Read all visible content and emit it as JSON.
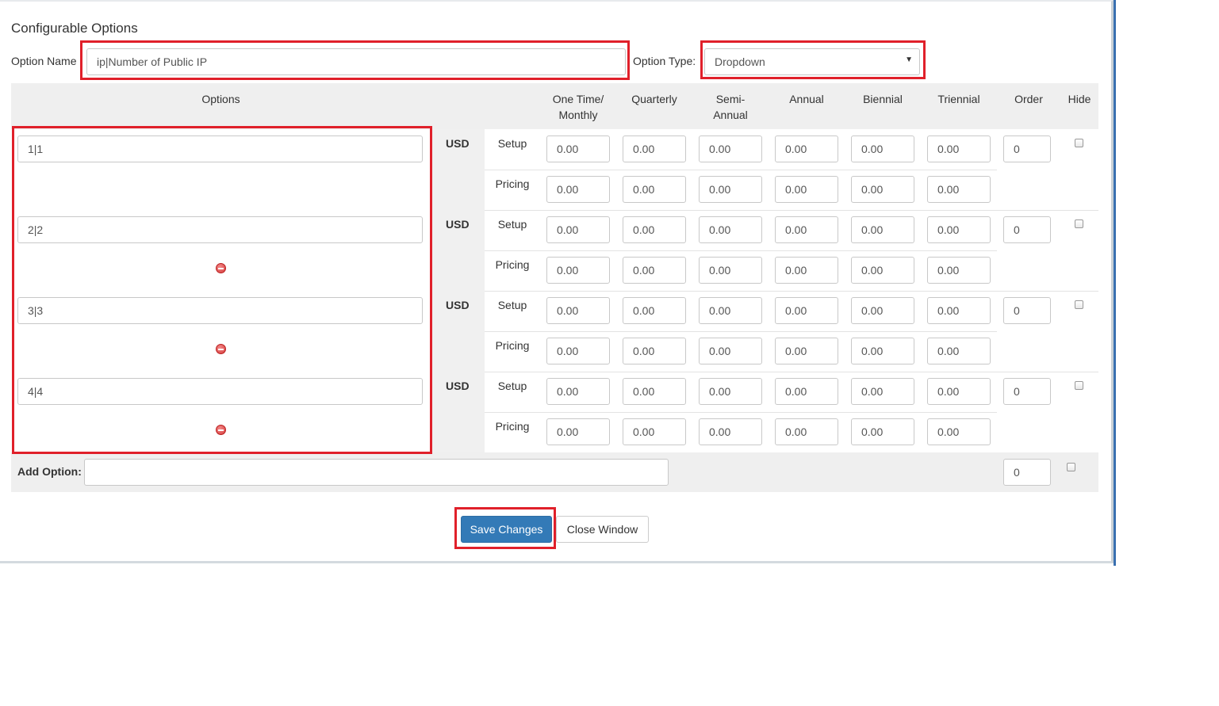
{
  "title": "Configurable Options",
  "option_name": {
    "label": "Option Name",
    "value": "ip|Number of Public IP"
  },
  "option_type": {
    "label": "Option Type:",
    "value": "Dropdown"
  },
  "columns": {
    "options": "Options",
    "one_time_a": "One Time/",
    "one_time_b": "Monthly",
    "quarterly": "Quarterly",
    "semi_a": "Semi-",
    "semi_b": "Annual",
    "annual": "Annual",
    "biennial": "Biennial",
    "triennial": "Triennial",
    "order": "Order",
    "hide": "Hide"
  },
  "currency": "USD",
  "setup_label": "Setup",
  "pricing_label": "Pricing",
  "rows": [
    {
      "name": "1|1",
      "setup": [
        "0.00",
        "0.00",
        "0.00",
        "0.00",
        "0.00",
        "0.00"
      ],
      "pricing": [
        "0.00",
        "0.00",
        "0.00",
        "0.00",
        "0.00",
        "0.00"
      ],
      "order": "0"
    },
    {
      "name": "2|2",
      "setup": [
        "0.00",
        "0.00",
        "0.00",
        "0.00",
        "0.00",
        "0.00"
      ],
      "pricing": [
        "0.00",
        "0.00",
        "0.00",
        "0.00",
        "0.00",
        "0.00"
      ],
      "order": "0"
    },
    {
      "name": "3|3",
      "setup": [
        "0.00",
        "0.00",
        "0.00",
        "0.00",
        "0.00",
        "0.00"
      ],
      "pricing": [
        "0.00",
        "0.00",
        "0.00",
        "0.00",
        "0.00",
        "0.00"
      ],
      "order": "0"
    },
    {
      "name": "4|4",
      "setup": [
        "0.00",
        "0.00",
        "0.00",
        "0.00",
        "0.00",
        "0.00"
      ],
      "pricing": [
        "0.00",
        "0.00",
        "0.00",
        "0.00",
        "0.00",
        "0.00"
      ],
      "order": "0"
    }
  ],
  "add_option": {
    "label": "Add Option:",
    "value": "",
    "order": "0"
  },
  "buttons": {
    "save": "Save Changes",
    "close": "Close Window"
  },
  "colors": {
    "highlight": "#e0202a",
    "primary": "#337ab7"
  }
}
